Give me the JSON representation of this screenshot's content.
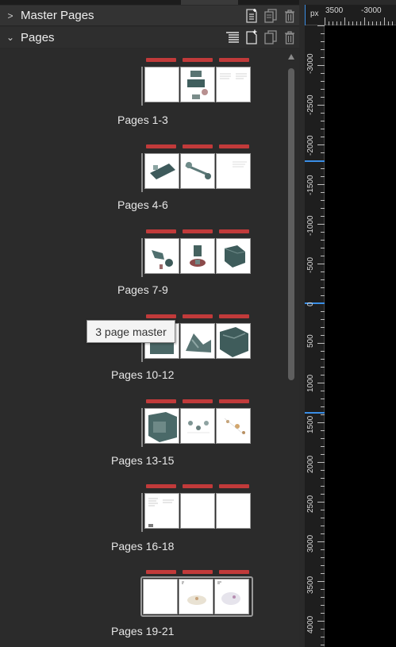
{
  "panels": {
    "master": {
      "title": "Master Pages",
      "expanded": false
    },
    "pages": {
      "title": "Pages",
      "expanded": true
    }
  },
  "header_icons": {
    "master": [
      "new-master-page-icon",
      "duplicate-master-page-icon",
      "delete-master-page-icon"
    ],
    "pages": [
      "page-options-icon",
      "add-page-icon",
      "duplicate-page-icon",
      "delete-page-icon"
    ]
  },
  "spreads": [
    {
      "label": "Pages 1-3"
    },
    {
      "label": "Pages 4-6"
    },
    {
      "label": "Pages 7-9"
    },
    {
      "label": "Pages 10-12"
    },
    {
      "label": "Pages 13-15"
    },
    {
      "label": "Pages 16-18"
    },
    {
      "label": "Pages 19-21",
      "selected": true
    }
  ],
  "tooltip": {
    "text": "3 page master"
  },
  "ruler": {
    "unit": "px",
    "top_labels": [
      "3500",
      "-3000"
    ],
    "left_labels": [
      "-3000",
      "-2500",
      "-2000",
      "-1500",
      "-1000",
      "-500",
      "0",
      "500",
      "1000",
      "1500",
      "2000",
      "2500",
      "3000",
      "3500",
      "4000"
    ]
  },
  "colors": {
    "accent_bar": "#c13a3a",
    "panel_bg": "#2b2b2b",
    "ruler_marker": "#3a8ee6"
  }
}
